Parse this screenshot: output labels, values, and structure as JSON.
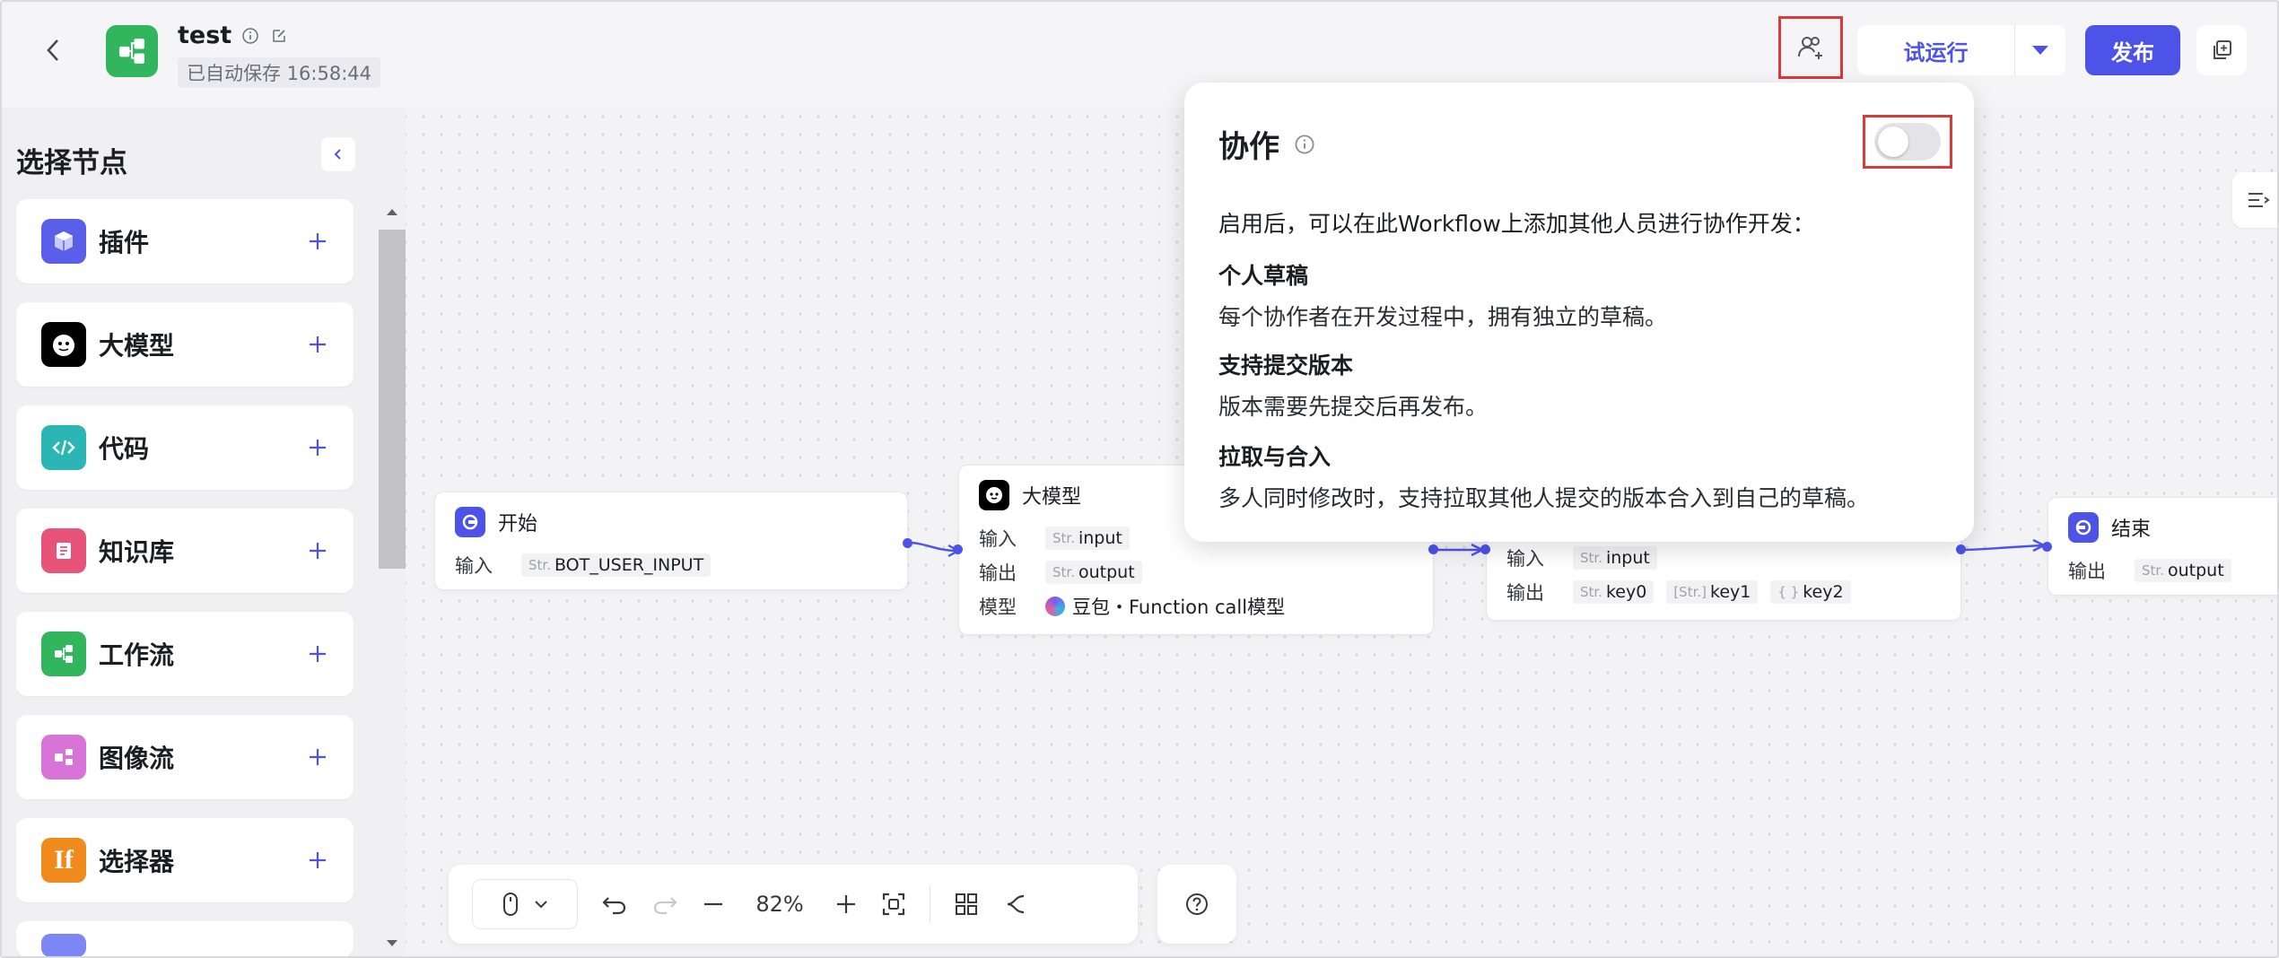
{
  "header": {
    "title": "test",
    "save_status": "已自动保存 16:58:44",
    "run_label": "试运行",
    "publish_label": "发布"
  },
  "panel": {
    "title": "选择节点",
    "items": [
      {
        "label": "插件",
        "icon": "plugin-icon",
        "color": "#5a5ee8"
      },
      {
        "label": "大模型",
        "icon": "llm-icon",
        "color": "#000000"
      },
      {
        "label": "代码",
        "icon": "code-icon",
        "color": "#2cb5b5"
      },
      {
        "label": "知识库",
        "icon": "knowledge-icon",
        "color": "#e8537a"
      },
      {
        "label": "工作流",
        "icon": "workflow-icon",
        "color": "#32b65d"
      },
      {
        "label": "图像流",
        "icon": "imageflow-icon",
        "color": "#d874d8"
      },
      {
        "label": "选择器",
        "icon": "selector-icon",
        "color": "#f08a1c"
      }
    ]
  },
  "nodes": {
    "start": {
      "title": "开始",
      "input_label": "输入",
      "input_type": "Str.",
      "input_value": "BOT_USER_INPUT"
    },
    "llm": {
      "title": "大模型",
      "input_label": "输入",
      "input_type": "Str.",
      "input_value": "input",
      "output_label": "输出",
      "output_type": "Str.",
      "output_value": "output",
      "model_label": "模型",
      "model_value": "豆包・Function call模型"
    },
    "code": {
      "input_label": "输入",
      "input_type": "Str.",
      "input_value": "input",
      "output_label": "输出",
      "outputs": [
        {
          "type": "Str.",
          "name": "key0"
        },
        {
          "type": "[Str.]",
          "name": "key1"
        },
        {
          "type": "{ }",
          "name": "key2"
        }
      ]
    },
    "end": {
      "title": "结束",
      "output_label": "输出",
      "output_type": "Str.",
      "output_value": "output"
    }
  },
  "popover": {
    "title": "协作",
    "description": "启用后，可以在此Workflow上添加其他人员进行协作开发：",
    "sections": [
      {
        "title": "个人草稿",
        "desc": "每个协作者在开发过程中，拥有独立的草稿。"
      },
      {
        "title": "支持提交版本",
        "desc": "版本需要先提交后再发布。"
      },
      {
        "title": "拉取与合入",
        "desc": "多人同时修改时，支持拉取其他人提交的版本合入到自己的草稿。"
      }
    ],
    "toggle_on": false
  },
  "toolbar": {
    "zoom": "82%"
  },
  "colors": {
    "accent": "#4d53e8",
    "highlight": "#d93a3a"
  }
}
